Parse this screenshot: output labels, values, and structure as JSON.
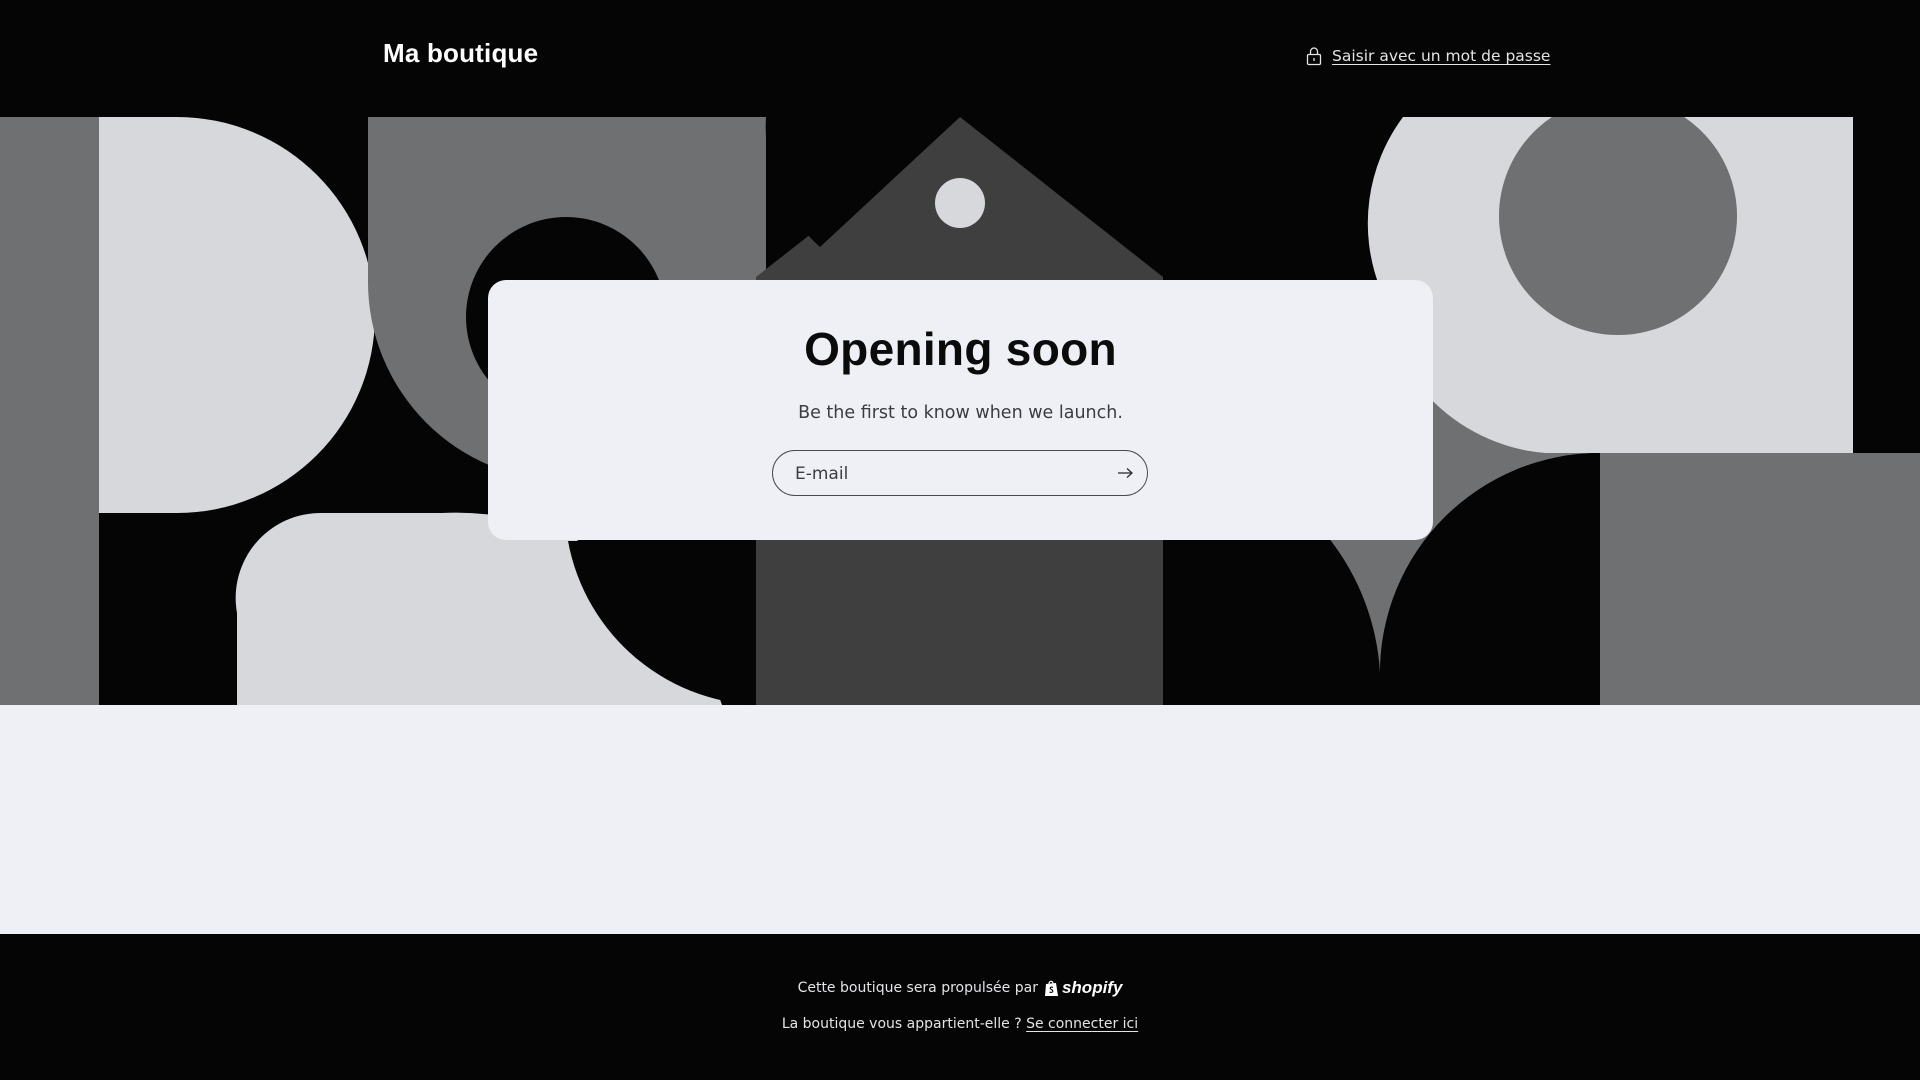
{
  "header": {
    "brand": "Ma boutique",
    "password_link": "Saisir avec un mot de passe",
    "lock_icon": "lock-icon"
  },
  "main": {
    "heading": "Opening soon",
    "subtext": "Be the first to know when we launch.",
    "email_placeholder": "E-mail",
    "email_value": "",
    "submit_icon": "arrow-right-icon"
  },
  "footer": {
    "powered_text": "Cette boutique sera propulsée par",
    "powered_logo": "shopify",
    "owner_text": "La boutique vous appartient-elle ?",
    "login_link": "Se connecter ici"
  },
  "colors": {
    "background": "#050506",
    "card": "#eff0f5",
    "shape_light": "#d7d8dc",
    "shape_mid": "#6f7072",
    "shape_dark": "#3f3f40"
  }
}
